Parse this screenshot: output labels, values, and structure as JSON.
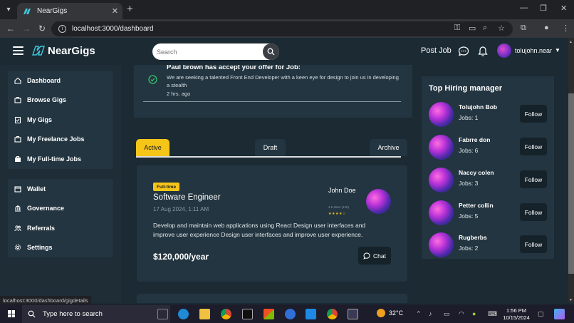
{
  "browser": {
    "tab_title": "NearGigs",
    "url": "localhost:3000/dashboard",
    "status_url": "localhost:3000/dashboard/gigdetails"
  },
  "header": {
    "logo_text": "NearGigs",
    "search_placeholder": "Search",
    "post_job": "Post Job",
    "username": "tolujohn.near"
  },
  "sidebar": {
    "group1": [
      {
        "label": "Dashboard",
        "icon": "home-icon"
      },
      {
        "label": "Browse Gigs",
        "icon": "briefcase-icon"
      },
      {
        "label": "My Gigs",
        "icon": "clipboard-icon"
      },
      {
        "label": "My Freelance Jobs",
        "icon": "briefcase-icon"
      },
      {
        "label": "My Full-time Jobs",
        "icon": "briefcase-filled-icon"
      }
    ],
    "group2": [
      {
        "label": "Wallet",
        "icon": "wallet-icon"
      },
      {
        "label": "Governance",
        "icon": "bank-icon"
      },
      {
        "label": "Referrals",
        "icon": "users-icon"
      },
      {
        "label": "Settings",
        "icon": "gear-icon"
      }
    ]
  },
  "notification": {
    "title": "Paul brown has accept your offer for Job:",
    "body": "We are seeking a talented Front End Developer with a keen eye for design to join us in developing a stealth",
    "time": "2 hrs. ago"
  },
  "tabs": [
    {
      "label": "Active",
      "active": true
    },
    {
      "label": "Draft",
      "active": false
    },
    {
      "label": "Archive",
      "active": false
    }
  ],
  "gig": {
    "badge": "Full-time",
    "title": "Software Engineer",
    "date": "17 Aug 2024, 1:11 AM",
    "poster": "John Doe",
    "rating_text": "4.5 stars (120)",
    "rating": 4.5,
    "rating_max": 5,
    "stars": "★★★★☆",
    "description": "Develop and maintain web applications using React Design user interfaces and improve user experience Design user interfaces and improve user experience.",
    "salary": "$120,000/year",
    "chat_label": "Chat"
  },
  "hiring": {
    "title": "Top Hiring manager",
    "follow_label": "Follow",
    "managers": [
      {
        "name": "Tolujohn Bob",
        "jobs": "Jobs: 1"
      },
      {
        "name": "Fabrre don",
        "jobs": "Jobs: 6"
      },
      {
        "name": "Naccy colen",
        "jobs": "Jobs: 3"
      },
      {
        "name": "Petter collin",
        "jobs": "Jobs: 5"
      },
      {
        "name": "Rugberbs",
        "jobs": "Jobs: 2"
      }
    ]
  },
  "taskbar": {
    "search_placeholder": "Type here to search",
    "temperature": "32°C",
    "time": "1:56 PM",
    "date": "10/15/2024"
  },
  "colors": {
    "accent": "#f5c518",
    "background": "#1b2a33",
    "card": "#233540",
    "success": "#35c26b"
  }
}
